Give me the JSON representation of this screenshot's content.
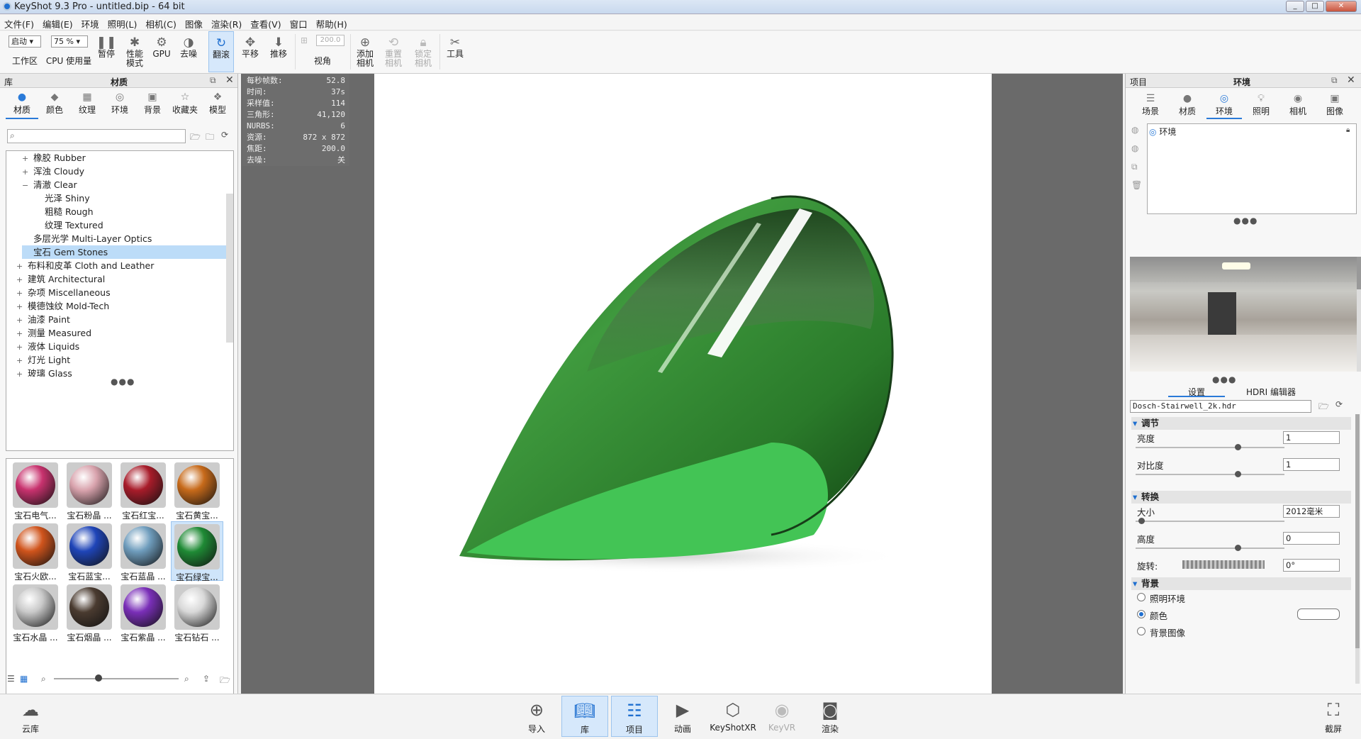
{
  "window": {
    "title": "KeyShot 9.3 Pro  - untitled.bip - 64 bit"
  },
  "menu": [
    "文件(F)",
    "编辑(E)",
    "环境",
    "照明(L)",
    "相机(C)",
    "图像",
    "渲染(R)",
    "查看(V)",
    "窗口",
    "帮助(H)"
  ],
  "toolbar": {
    "mode_select": "启动",
    "zoom_select": "75 %",
    "workspace": "工作区",
    "cpu": "CPU",
    "usage": "使用量",
    "pause": "暂停",
    "perf_mode_1": "性能",
    "perf_mode_2": "模式",
    "gpu": "GPU",
    "denoise": "去噪",
    "tumble": "翻滚",
    "pan": "平移",
    "dolly": "推移",
    "fov_value": "200.0",
    "fov": "视角",
    "add_camera_1": "添加",
    "add_camera_2": "相机",
    "reset_camera_1": "重置",
    "reset_camera_2": "相机",
    "lock_camera_1": "锁定",
    "lock_camera_2": "相机",
    "tools": "工具"
  },
  "library": {
    "header_left": "库",
    "header_title": "材质",
    "tabs": [
      "材质",
      "颜色",
      "纹理",
      "环境",
      "背景",
      "收藏夹",
      "模型"
    ],
    "search_placeholder": "",
    "tree": [
      {
        "pm": "+",
        "label": "橡胶 Rubber"
      },
      {
        "pm": "+",
        "label": "浑浊 Cloudy"
      },
      {
        "pm": "−",
        "label": "清澈 Clear"
      },
      {
        "pm": "",
        "label": "光泽 Shiny"
      },
      {
        "pm": "",
        "label": "粗糙 Rough"
      },
      {
        "pm": "",
        "label": "纹理 Textured"
      },
      {
        "pm": "",
        "label": "多层光学 Multi-Layer Optics"
      },
      {
        "pm": "",
        "label": "宝石 Gem Stones"
      },
      {
        "pm": "+",
        "label": "布料和皮革 Cloth and Leather"
      },
      {
        "pm": "+",
        "label": "建筑 Architectural"
      },
      {
        "pm": "+",
        "label": "杂项 Miscellaneous"
      },
      {
        "pm": "+",
        "label": "模德蚀纹 Mold-Tech"
      },
      {
        "pm": "+",
        "label": "油漆 Paint"
      },
      {
        "pm": "+",
        "label": "测量 Measured"
      },
      {
        "pm": "+",
        "label": "液体 Liquids"
      },
      {
        "pm": "+",
        "label": "灯光 Light"
      },
      {
        "pm": "+",
        "label": "玻璃 Glass"
      }
    ],
    "thumbnails": [
      {
        "label": "宝石电气...",
        "color": "#c8326e"
      },
      {
        "label": "宝石粉晶 ...",
        "color": "#d9a3ad"
      },
      {
        "label": "宝石红宝...",
        "color": "#a81c2a"
      },
      {
        "label": "宝石黄宝...",
        "color": "#c76a1a"
      },
      {
        "label": "宝石火欧...",
        "color": "#d0541c"
      },
      {
        "label": "宝石蓝宝...",
        "color": "#1f45b8"
      },
      {
        "label": "宝石蓝晶 ...",
        "color": "#6f9dbd"
      },
      {
        "label": "宝石绿宝...",
        "color": "#1f8a35"
      },
      {
        "label": "宝石水晶 ...",
        "color": "#c9c9c9"
      },
      {
        "label": "宝石烟晶 ...",
        "color": "#4a3b30"
      },
      {
        "label": "宝石紫晶 ...",
        "color": "#7a2fb8"
      },
      {
        "label": "宝石钻石 ...",
        "color": "#d8d8d8"
      }
    ]
  },
  "stats": [
    {
      "k": "每秒帧数:",
      "v": "52.8"
    },
    {
      "k": "时间:",
      "v": "37s"
    },
    {
      "k": "采样值:",
      "v": "114"
    },
    {
      "k": "三角形:",
      "v": "41,120"
    },
    {
      "k": "NURBS:",
      "v": "6"
    },
    {
      "k": "资源:",
      "v": "872 x 872"
    },
    {
      "k": "焦距:",
      "v": "200.0"
    },
    {
      "k": "去噪:",
      "v": "关"
    }
  ],
  "project": {
    "header_left": "项目",
    "header_title": "环境",
    "tabs": [
      "场景",
      "材质",
      "环境",
      "照明",
      "相机",
      "图像"
    ],
    "env_item": "环境",
    "subtabs": [
      "设置",
      "HDRI 编辑器"
    ],
    "hdri_file": "Dosch-Stairwell_2k.hdr",
    "adjust": {
      "title": "调节",
      "brightness_label": "亮度",
      "brightness": "1",
      "contrast_label": "对比度",
      "contrast": "1"
    },
    "transform": {
      "title": "转换",
      "size_label": "大小",
      "size": "2012毫米",
      "height_label": "高度",
      "height": "0",
      "rotation_label": "旋转:",
      "rotation": "0°"
    },
    "background": {
      "title": "背景",
      "opt1": "照明环境",
      "opt2": "颜色",
      "opt3": "背景图像",
      "selected": 2,
      "color": "#ffffff"
    }
  },
  "bottom": {
    "cloud": "云库",
    "import": "导入",
    "library": "库",
    "project": "项目",
    "animation": "动画",
    "keyshotxr": "KeyShotXR",
    "keyvr": "KeyVR",
    "render": "渲染",
    "screenshot": "截屏"
  }
}
